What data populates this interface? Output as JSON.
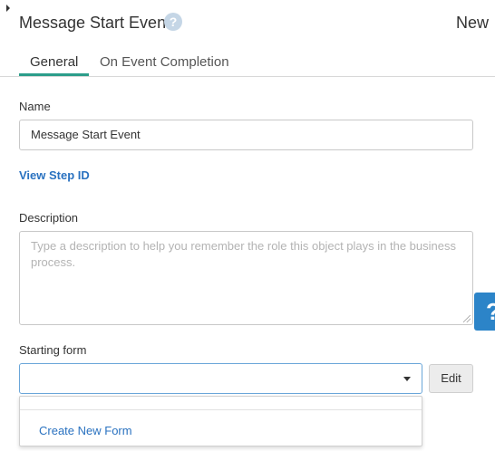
{
  "header": {
    "title": "Message Start Event",
    "help_icon": "?",
    "status": "New"
  },
  "tabs": [
    {
      "label": "General",
      "active": true
    },
    {
      "label": "On Event Completion",
      "active": false
    }
  ],
  "form": {
    "name_label": "Name",
    "name_value": "Message Start Event",
    "view_step_link": "View Step ID",
    "description_label": "Description",
    "description_placeholder": "Type a description to help you remember the role this object plays in the business process.",
    "starting_form_label": "Starting form",
    "starting_form_value": "",
    "edit_button": "Edit",
    "dropdown_options": [
      "",
      "Create New Form"
    ]
  },
  "side_help": "?",
  "colors": {
    "accent_tab": "#2c9d8a",
    "link": "#2a72c0",
    "side_help_bg": "#2c84c8"
  }
}
